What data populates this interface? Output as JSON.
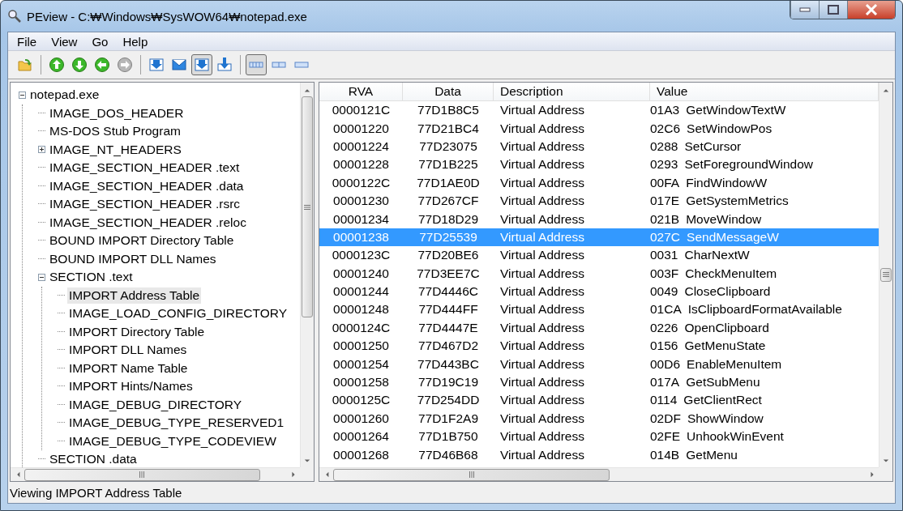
{
  "window": {
    "title": "PEview - C:₩Windows₩SysWOW64₩notepad.exe"
  },
  "menu": [
    "File",
    "View",
    "Go",
    "Help"
  ],
  "toolbar": {
    "groups": [
      {
        "buttons": [
          {
            "kind": "open",
            "disabled": false,
            "pressed": false
          }
        ]
      },
      {
        "buttons": [
          {
            "kind": "up",
            "disabled": false,
            "pressed": false
          },
          {
            "kind": "down",
            "disabled": false,
            "pressed": false
          },
          {
            "kind": "back",
            "disabled": false,
            "pressed": false
          },
          {
            "kind": "forward",
            "disabled": true,
            "pressed": false
          }
        ]
      },
      {
        "buttons": [
          {
            "kind": "tray",
            "disabled": false,
            "pressed": false
          },
          {
            "kind": "envelope",
            "disabled": false,
            "pressed": false
          },
          {
            "kind": "tray",
            "disabled": false,
            "pressed": true
          },
          {
            "kind": "download",
            "disabled": false,
            "pressed": false
          }
        ]
      },
      {
        "buttons": [
          {
            "kind": "quad",
            "disabled": false,
            "pressed": true
          },
          {
            "kind": "dual",
            "disabled": false,
            "pressed": false
          },
          {
            "kind": "single",
            "disabled": false,
            "pressed": false
          }
        ]
      }
    ]
  },
  "tree": [
    {
      "label": "notepad.exe",
      "selected": false,
      "expanded": true,
      "children": [
        {
          "label": "IMAGE_DOS_HEADER",
          "selected": false
        },
        {
          "label": "MS-DOS Stub Program",
          "selected": false
        },
        {
          "label": "IMAGE_NT_HEADERS",
          "selected": false,
          "expanded": false
        },
        {
          "label": "IMAGE_SECTION_HEADER .text",
          "selected": false
        },
        {
          "label": "IMAGE_SECTION_HEADER .data",
          "selected": false
        },
        {
          "label": "IMAGE_SECTION_HEADER .rsrc",
          "selected": false
        },
        {
          "label": "IMAGE_SECTION_HEADER .reloc",
          "selected": false
        },
        {
          "label": "BOUND IMPORT Directory Table",
          "selected": false
        },
        {
          "label": "BOUND IMPORT DLL Names",
          "selected": false
        },
        {
          "label": "SECTION .text",
          "selected": false,
          "expanded": true,
          "children": [
            {
              "label": "IMPORT Address Table",
              "selected": true
            },
            {
              "label": "IMAGE_LOAD_CONFIG_DIRECTORY",
              "selected": false
            },
            {
              "label": "IMPORT Directory Table",
              "selected": false
            },
            {
              "label": "IMPORT DLL Names",
              "selected": false
            },
            {
              "label": "IMPORT Name Table",
              "selected": false
            },
            {
              "label": "IMPORT Hints/Names",
              "selected": false
            },
            {
              "label": "IMAGE_DEBUG_DIRECTORY",
              "selected": false
            },
            {
              "label": "IMAGE_DEBUG_TYPE_RESERVED1",
              "selected": false
            },
            {
              "label": "IMAGE_DEBUG_TYPE_CODEVIEW",
              "selected": false
            }
          ]
        },
        {
          "label": "SECTION .data",
          "selected": false
        }
      ]
    }
  ],
  "table": {
    "columns": [
      "RVA",
      "Data",
      "Description",
      "Value"
    ],
    "rows": [
      {
        "rva": "0000121C",
        "data": "77D1B8C5",
        "description": "Virtual Address",
        "hint": "01A3",
        "name": "GetWindowTextW",
        "selected": false
      },
      {
        "rva": "00001220",
        "data": "77D21BC4",
        "description": "Virtual Address",
        "hint": "02C6",
        "name": "SetWindowPos",
        "selected": false
      },
      {
        "rva": "00001224",
        "data": "77D23075",
        "description": "Virtual Address",
        "hint": "0288",
        "name": "SetCursor",
        "selected": false
      },
      {
        "rva": "00001228",
        "data": "77D1B225",
        "description": "Virtual Address",
        "hint": "0293",
        "name": "SetForegroundWindow",
        "selected": false
      },
      {
        "rva": "0000122C",
        "data": "77D1AE0D",
        "description": "Virtual Address",
        "hint": "00FA",
        "name": "FindWindowW",
        "selected": false
      },
      {
        "rva": "00001230",
        "data": "77D267CF",
        "description": "Virtual Address",
        "hint": "017E",
        "name": "GetSystemMetrics",
        "selected": false
      },
      {
        "rva": "00001234",
        "data": "77D18D29",
        "description": "Virtual Address",
        "hint": "021B",
        "name": "MoveWindow",
        "selected": false
      },
      {
        "rva": "00001238",
        "data": "77D25539",
        "description": "Virtual Address",
        "hint": "027C",
        "name": "SendMessageW",
        "selected": true
      },
      {
        "rva": "0000123C",
        "data": "77D20BE6",
        "description": "Virtual Address",
        "hint": "0031",
        "name": "CharNextW",
        "selected": false
      },
      {
        "rva": "00001240",
        "data": "77D3EE7C",
        "description": "Virtual Address",
        "hint": "003F",
        "name": "CheckMenuItem",
        "selected": false
      },
      {
        "rva": "00001244",
        "data": "77D4446C",
        "description": "Virtual Address",
        "hint": "0049",
        "name": "CloseClipboard",
        "selected": false
      },
      {
        "rva": "00001248",
        "data": "77D444FF",
        "description": "Virtual Address",
        "hint": "01CA",
        "name": "IsClipboardFormatAvailable",
        "selected": false
      },
      {
        "rva": "0000124C",
        "data": "77D4447E",
        "description": "Virtual Address",
        "hint": "0226",
        "name": "OpenClipboard",
        "selected": false
      },
      {
        "rva": "00001250",
        "data": "77D467D2",
        "description": "Virtual Address",
        "hint": "0156",
        "name": "GetMenuState",
        "selected": false
      },
      {
        "rva": "00001254",
        "data": "77D443BC",
        "description": "Virtual Address",
        "hint": "00D6",
        "name": "EnableMenuItem",
        "selected": false
      },
      {
        "rva": "00001258",
        "data": "77D19C19",
        "description": "Virtual Address",
        "hint": "017A",
        "name": "GetSubMenu",
        "selected": false
      },
      {
        "rva": "0000125C",
        "data": "77D254DD",
        "description": "Virtual Address",
        "hint": "0114",
        "name": "GetClientRect",
        "selected": false
      },
      {
        "rva": "00001260",
        "data": "77D1F2A9",
        "description": "Virtual Address",
        "hint": "02DF",
        "name": "ShowWindow",
        "selected": false
      },
      {
        "rva": "00001264",
        "data": "77D1B750",
        "description": "Virtual Address",
        "hint": "02FE",
        "name": "UnhookWinEvent",
        "selected": false
      },
      {
        "rva": "00001268",
        "data": "77D46B68",
        "description": "Virtual Address",
        "hint": "014B",
        "name": "GetMenu",
        "selected": false
      }
    ]
  },
  "status_bar": "Viewing IMPORT Address Table"
}
